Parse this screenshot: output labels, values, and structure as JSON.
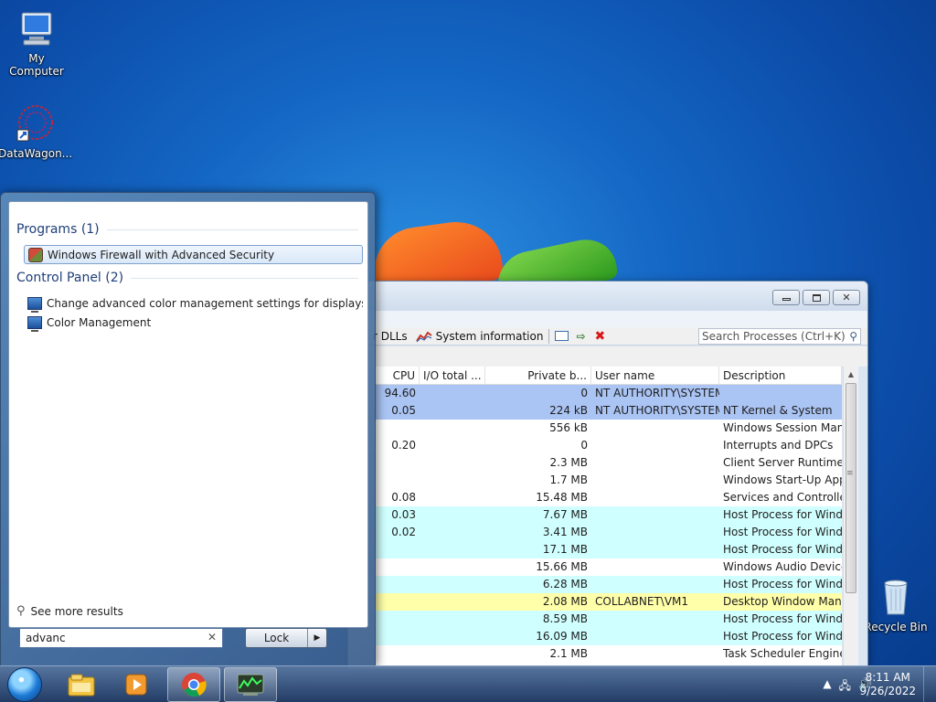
{
  "desktop": {
    "icons": [
      {
        "label": "My Computer",
        "icon": "computer-icon"
      },
      {
        "label": "DataWagon...",
        "icon": "datawagon-icon"
      },
      {
        "label": "Recycle Bin",
        "icon": "recycle-bin-icon"
      }
    ]
  },
  "process_explorer": {
    "toolbar": {
      "dlls_label": "r DLLs",
      "sysinfo_label": "System information"
    },
    "search_placeholder": "Search Processes (Ctrl+K)",
    "columns": [
      "CPU",
      "I/O total ...",
      "Private b...",
      "User name",
      "Description"
    ],
    "rows": [
      {
        "cpu": "94.60",
        "io": "",
        "private": "0",
        "user": "NT AUTHORITY\\SYSTEM",
        "desc": "",
        "color": "#aac4f4"
      },
      {
        "cpu": "0.05",
        "io": "",
        "private": "224 kB",
        "user": "NT AUTHORITY\\SYSTEM",
        "desc": "NT Kernel & System",
        "color": "#aac4f4"
      },
      {
        "cpu": "",
        "io": "",
        "private": "556 kB",
        "user": "",
        "desc": "Windows Session Manager",
        "color": "#ffffff"
      },
      {
        "cpu": "0.20",
        "io": "",
        "private": "0",
        "user": "",
        "desc": "Interrupts and DPCs",
        "color": "#ffffff"
      },
      {
        "cpu": "",
        "io": "",
        "private": "2.3 MB",
        "user": "",
        "desc": "Client Server Runtime Process",
        "color": "#ffffff"
      },
      {
        "cpu": "",
        "io": "",
        "private": "1.7 MB",
        "user": "",
        "desc": "Windows Start-Up Application",
        "color": "#ffffff"
      },
      {
        "cpu": "0.08",
        "io": "",
        "private": "15.48 MB",
        "user": "",
        "desc": "Services and Controller app",
        "color": "#ffffff"
      },
      {
        "cpu": "0.03",
        "io": "",
        "private": "7.67 MB",
        "user": "",
        "desc": "Host Process for Windows Ser...",
        "color": "#d0ffff"
      },
      {
        "cpu": "0.02",
        "io": "",
        "private": "3.41 MB",
        "user": "",
        "desc": "Host Process for Windows Ser...",
        "color": "#d0ffff"
      },
      {
        "cpu": "",
        "io": "",
        "private": "17.1 MB",
        "user": "",
        "desc": "Host Process for Windows Ser...",
        "color": "#d0ffff"
      },
      {
        "cpu": "",
        "io": "",
        "private": "15.66 MB",
        "user": "",
        "desc": "Windows Audio Device Graph...",
        "color": "#ffffff"
      },
      {
        "cpu": "",
        "io": "",
        "private": "6.28 MB",
        "user": "",
        "desc": "Host Process for Windows Ser...",
        "color": "#d0ffff"
      },
      {
        "cpu": "",
        "io": "",
        "private": "2.08 MB",
        "user": "COLLABNET\\VM1",
        "desc": "Desktop Window Manager",
        "color": "#ffffaa"
      },
      {
        "cpu": "",
        "io": "",
        "private": "8.59 MB",
        "user": "",
        "desc": "Host Process for Windows Ser...",
        "color": "#d0ffff"
      },
      {
        "cpu": "",
        "io": "",
        "private": "16.09 MB",
        "user": "",
        "desc": "Host Process for Windows Ser...",
        "color": "#d0ffff"
      },
      {
        "cpu": "",
        "io": "",
        "private": "2.1 MB",
        "user": "",
        "desc": "Task Scheduler Engine",
        "color": "#ffffff"
      }
    ]
  },
  "start_menu": {
    "programs_header": "Programs (1)",
    "programs": [
      {
        "label": "Windows Firewall with Advanced Security",
        "icon": "firewall-icon"
      }
    ],
    "control_panel_header": "Control Panel (2)",
    "control_panel": [
      {
        "label": "Change advanced color management settings for displays, sca...",
        "icon": "monitor-icon"
      },
      {
        "label": "Color Management",
        "icon": "monitor-icon"
      }
    ],
    "see_more": "See more results",
    "search_value": "advanc",
    "lock_label": "Lock"
  },
  "taskbar": {
    "time": "8:11 AM",
    "date": "9/26/2022",
    "pinned": [
      "file-explorer-icon",
      "media-player-icon",
      "chrome-icon",
      "process-explorer-icon"
    ]
  }
}
